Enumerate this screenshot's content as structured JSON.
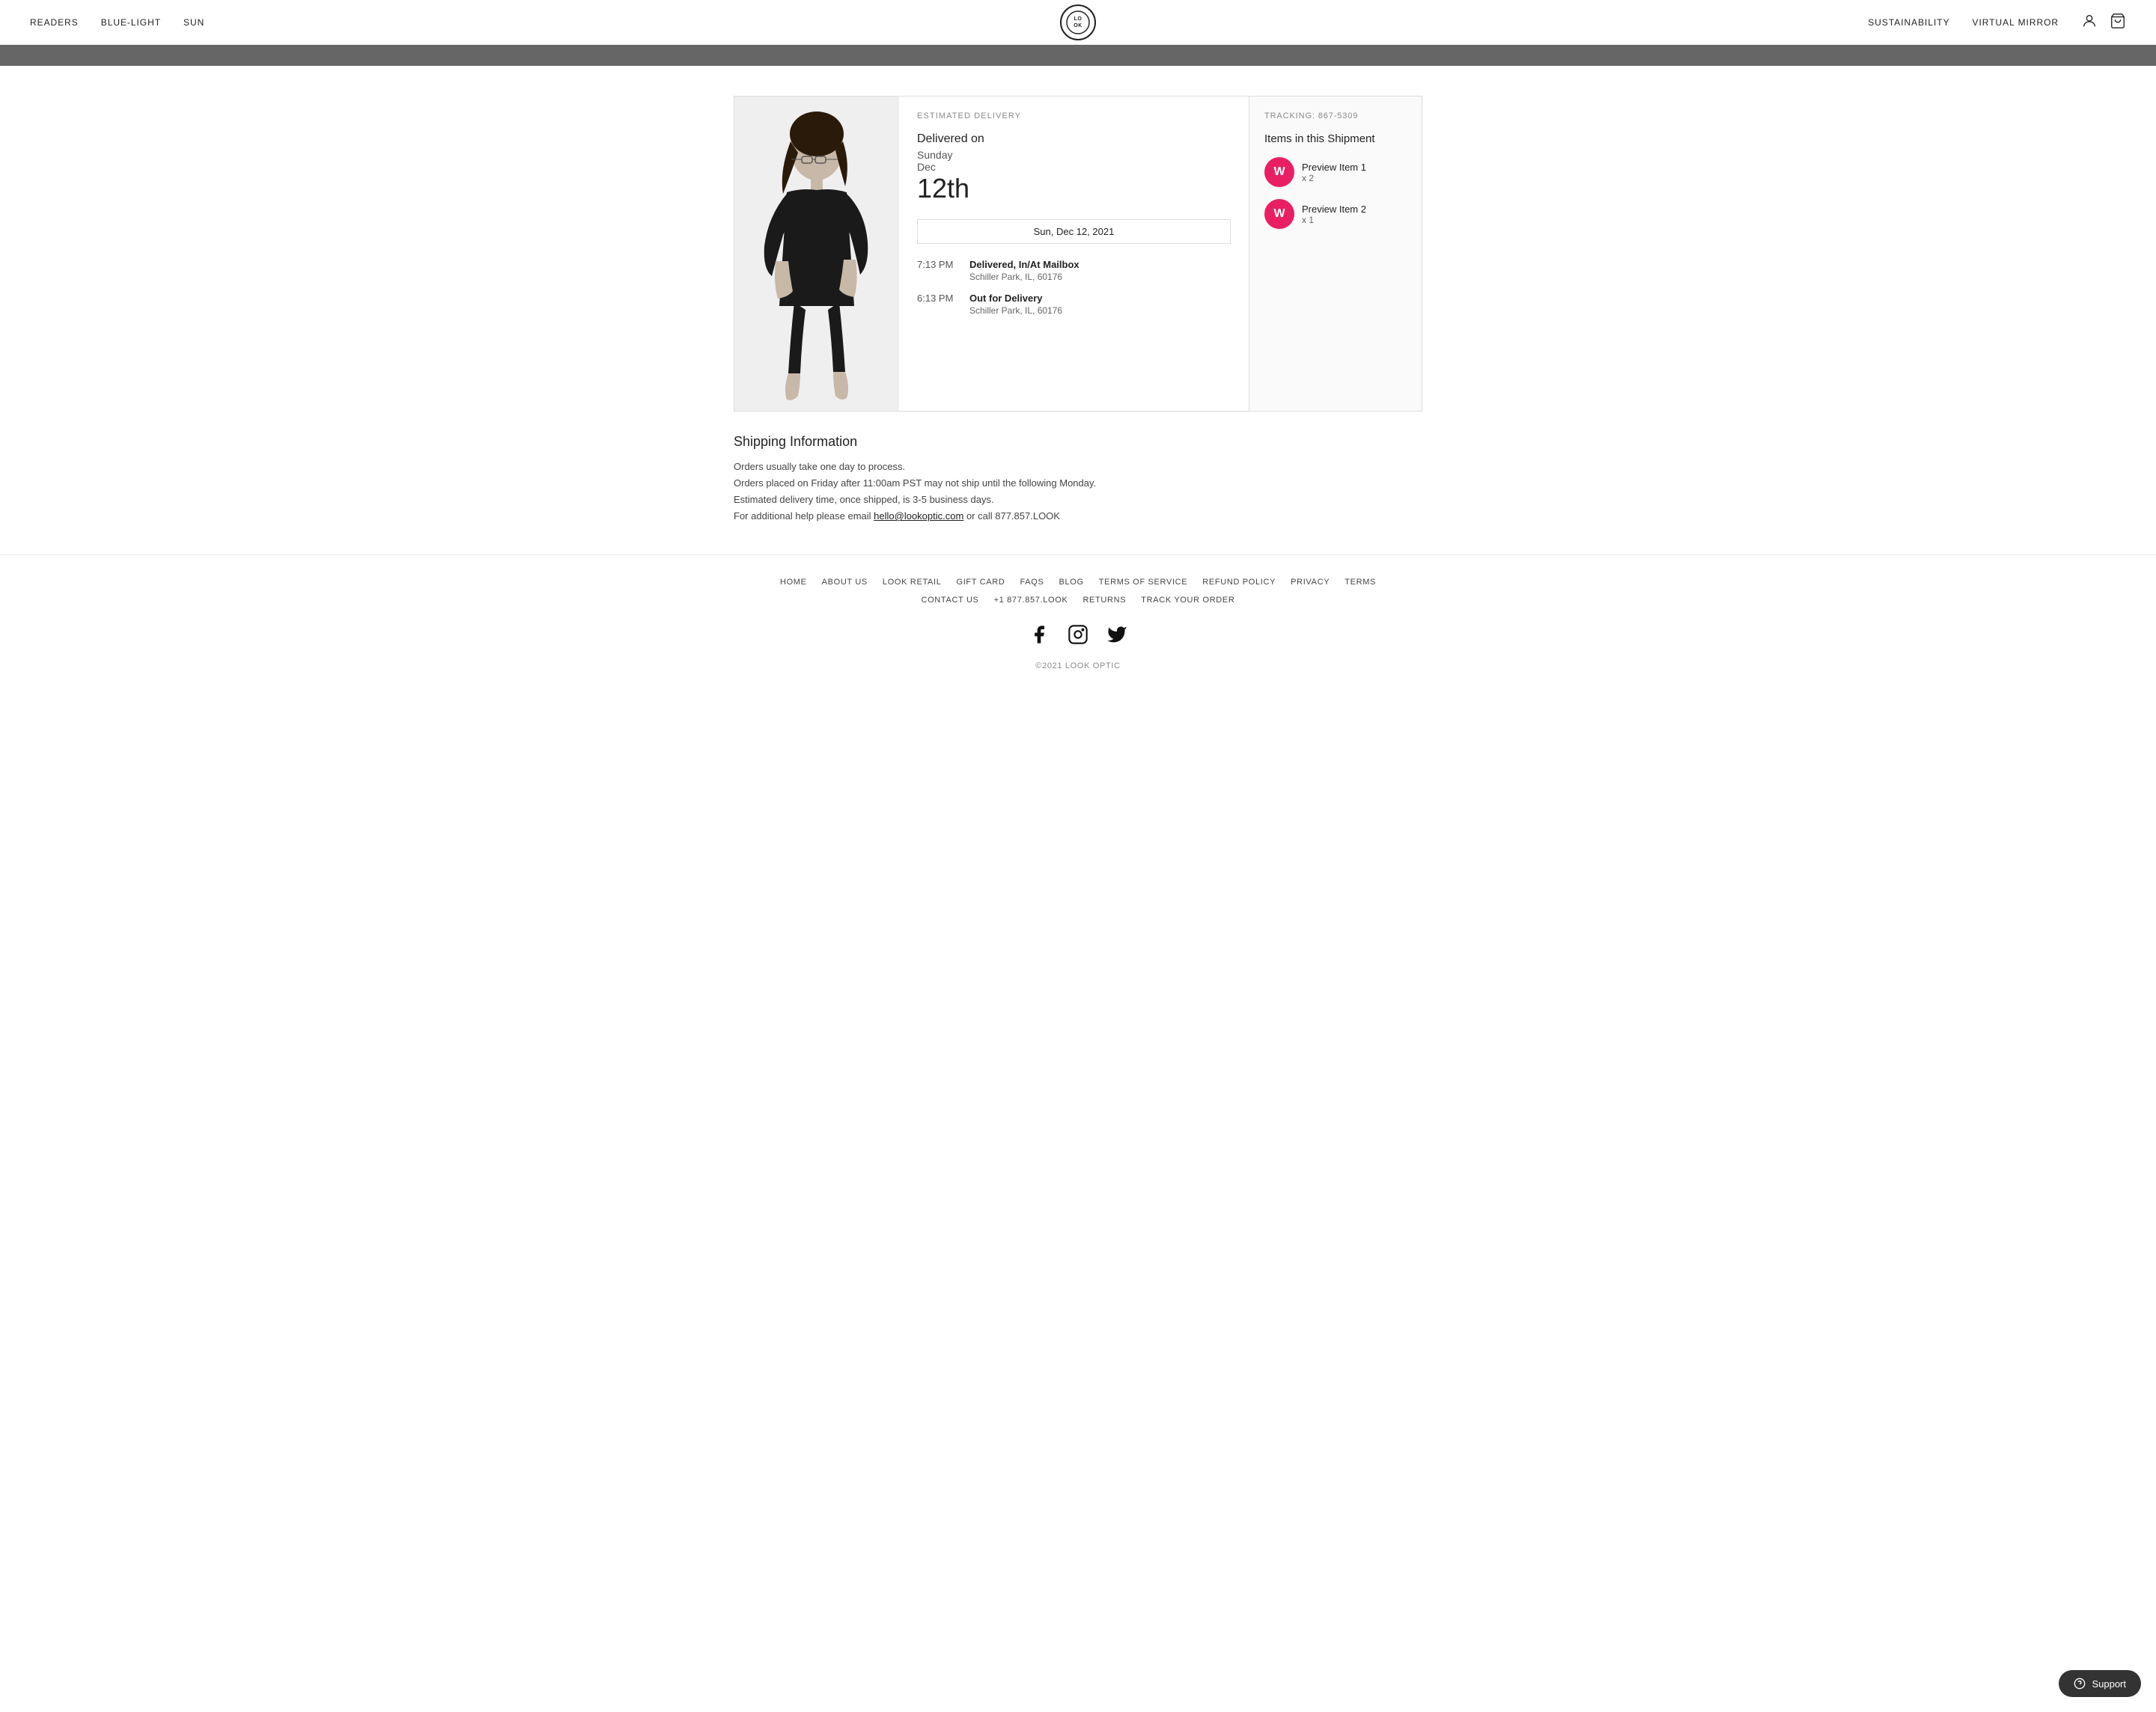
{
  "header": {
    "nav_left": [
      {
        "label": "READERS",
        "href": "#"
      },
      {
        "label": "BLUE-LIGHT",
        "href": "#"
      },
      {
        "label": "SUN",
        "href": "#"
      }
    ],
    "logo": "LO\nOK",
    "nav_right": [
      {
        "label": "SUSTAINABILITY",
        "href": "#"
      },
      {
        "label": "VIRTUAL MIRROR",
        "href": "#"
      }
    ]
  },
  "announcement": "",
  "tracking": {
    "section_label": "ESTIMATED DELIVERY",
    "delivered_on": "Delivered on",
    "day": "Sunday",
    "month": "Dec",
    "date": "12th",
    "date_badge": "Sun, Dec 12, 2021",
    "events": [
      {
        "time": "7:13 PM",
        "status": "Delivered, In/At Mailbox",
        "location": "Schiller Park, IL, 60176"
      },
      {
        "time": "6:13 PM",
        "status": "Out for Delivery",
        "location": "Schiller Park, IL, 60176"
      }
    ],
    "tracking_label": "TRACKING: 867-5309",
    "shipment_title": "Items in this Shipment",
    "items": [
      {
        "name": "Preview Item 1",
        "qty": "x 2"
      },
      {
        "name": "Preview Item 2",
        "qty": "x 1"
      }
    ]
  },
  "shipping_info": {
    "title": "Shipping Information",
    "lines": [
      "Orders usually take one day to process.",
      "Orders placed on Friday after 11:00am PST may not ship until the following Monday.",
      "Estimated delivery time, once shipped, is 3-5 business days.",
      "For additional help please email hello@lookoptic.com or call 877.857.LOOK"
    ]
  },
  "footer": {
    "links_row1": [
      {
        "label": "HOME",
        "href": "#"
      },
      {
        "label": "ABOUT US",
        "href": "#"
      },
      {
        "label": "LOOK RETAIL",
        "href": "#"
      },
      {
        "label": "GIFT CARD",
        "href": "#"
      },
      {
        "label": "FAQS",
        "href": "#"
      },
      {
        "label": "BLOG",
        "href": "#"
      },
      {
        "label": "TERMS OF SERVICE",
        "href": "#"
      },
      {
        "label": "REFUND POLICY",
        "href": "#"
      },
      {
        "label": "PRIVACY",
        "href": "#"
      },
      {
        "label": "TERMS",
        "href": "#"
      }
    ],
    "links_row2": [
      {
        "label": "CONTACT US",
        "href": "#"
      },
      {
        "label": "+1 877.857.LOOK",
        "href": "#"
      },
      {
        "label": "RETURNS",
        "href": "#"
      },
      {
        "label": "TRACK YOUR ORDER",
        "href": "#"
      }
    ],
    "copyright": "©2021 LOOK OPTIC"
  },
  "support_btn": "Support"
}
